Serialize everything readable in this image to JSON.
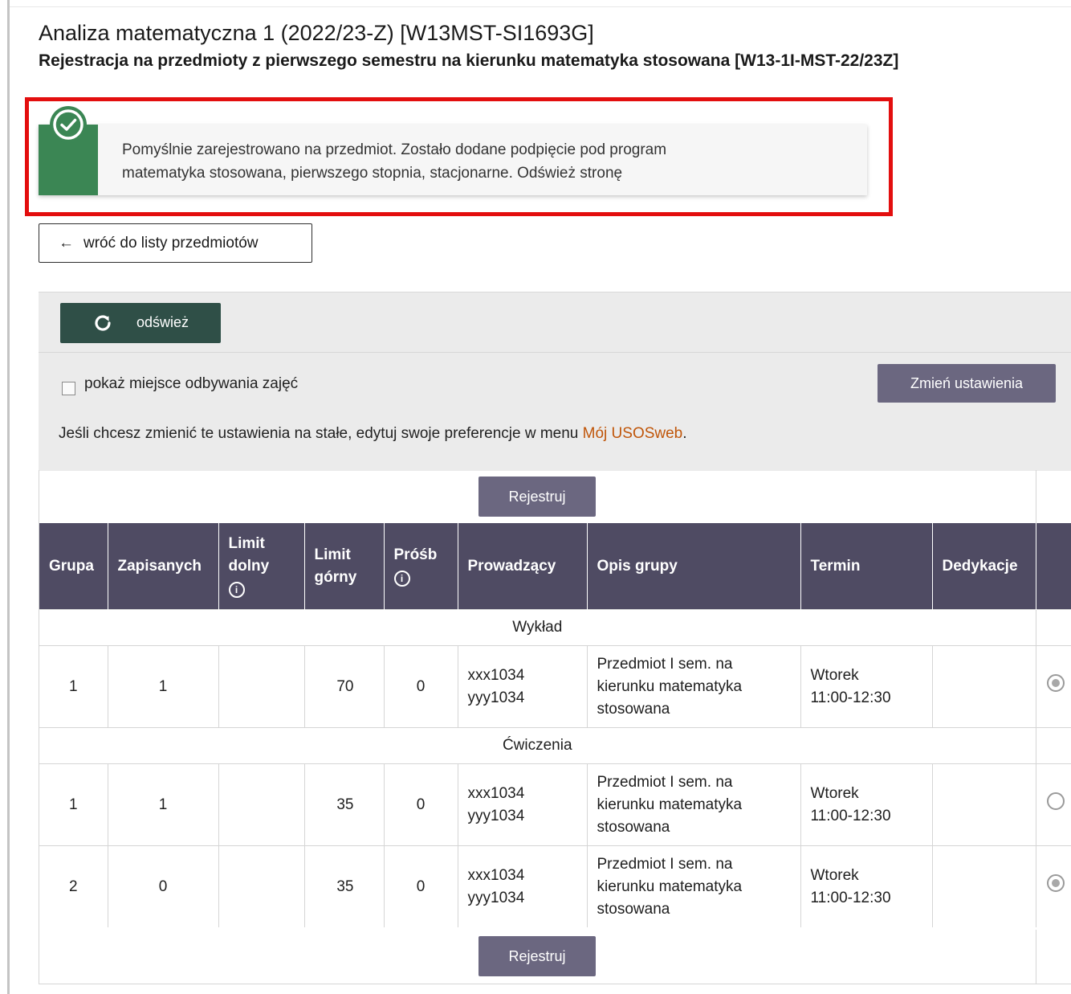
{
  "page": {
    "title": "Analiza matematyczna 1 (2022/23-Z) [W13MST-SI1693G]",
    "subtitle": "Rejestracja na przedmioty z pierwszego semestru na kierunku matematyka stosowana [W13-1I-MST-22/23Z]"
  },
  "alert": {
    "line1": "Pomyślnie zarejestrowano na przedmiot. Zostało dodane podpięcie pod program",
    "line2": "matematyka stosowana, pierwszego stopnia, stacjonarne. Odśwież stronę",
    "icon": "check-circle-icon",
    "color": "#3b8654",
    "highlight_color": "#e30e0e"
  },
  "back_button": {
    "arrow": "←",
    "label": "wróć do listy przedmiotów"
  },
  "settings": {
    "refresh_label": "odśwież",
    "show_location_label": "pokaż miejsce odbywania zajęć",
    "change_settings_label": "Zmień ustawienia",
    "prefs_text": "Jeśli chcesz zmienić te ustawienia na stałe, edytuj swoje preferencje w menu ",
    "prefs_link": "Mój USOSweb",
    "prefs_suffix": "."
  },
  "table": {
    "register_label": "Rejestruj",
    "headers": {
      "grupa": "Grupa",
      "zapisanych": "Zapisanych",
      "limit_dolny_1": "Limit",
      "limit_dolny_2": "dolny",
      "limit_gorny_1": "Limit",
      "limit_gorny_2": "górny",
      "prosb": "Próśb",
      "prowadzacy": "Prowadzący",
      "opis": "Opis grupy",
      "termin": "Termin",
      "dedykacje": "Dedykacje"
    },
    "sections": [
      {
        "name": "Wykład",
        "rows": [
          {
            "grupa": "1",
            "zapisanych": "1",
            "limit_dolny": "",
            "limit_gorny": "70",
            "prosb": "0",
            "prowadzacy_1": "xxx1034",
            "prowadzacy_2": "yyy1034",
            "opis_1": "Przedmiot I sem. na",
            "opis_2": "kierunku matematyka",
            "opis_3": "stosowana",
            "termin_1": "Wtorek",
            "termin_2": "11:00-12:30",
            "dedykacje": "",
            "selected": true
          }
        ]
      },
      {
        "name": "Ćwiczenia",
        "rows": [
          {
            "grupa": "1",
            "zapisanych": "1",
            "limit_dolny": "",
            "limit_gorny": "35",
            "prosb": "0",
            "prowadzacy_1": "xxx1034",
            "prowadzacy_2": "yyy1034",
            "opis_1": "Przedmiot I sem. na",
            "opis_2": "kierunku matematyka",
            "opis_3": "stosowana",
            "termin_1": "Wtorek",
            "termin_2": "11:00-12:30",
            "dedykacje": "",
            "selected": false
          },
          {
            "grupa": "2",
            "zapisanych": "0",
            "limit_dolny": "",
            "limit_gorny": "35",
            "prosb": "0",
            "prowadzacy_1": "xxx1034",
            "prowadzacy_2": "yyy1034",
            "opis_1": "Przedmiot I sem. na",
            "opis_2": "kierunku matematyka",
            "opis_3": "stosowana",
            "termin_1": "Wtorek",
            "termin_2": "11:00-12:30",
            "dedykacje": "",
            "selected": true
          }
        ]
      }
    ]
  }
}
